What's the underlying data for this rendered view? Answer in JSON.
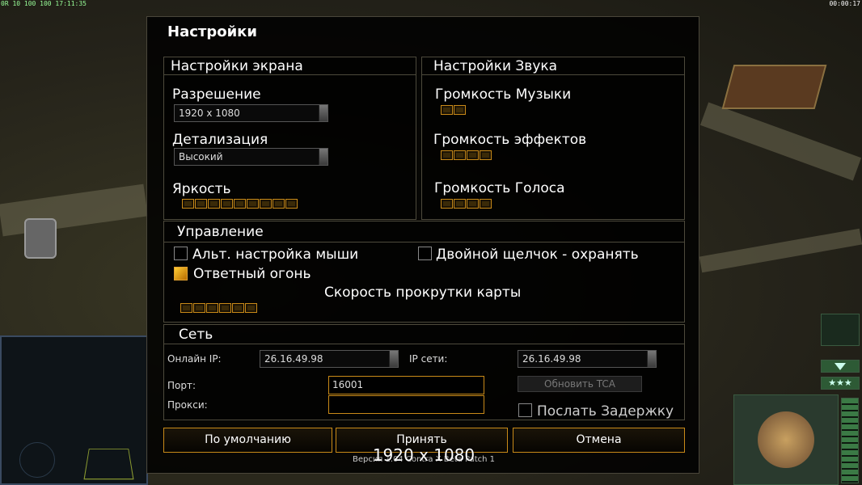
{
  "hud": {
    "top_left": "0R 10 100 100 17:11:35",
    "top_right": "00:00:17"
  },
  "dialog": {
    "title": "Настройки",
    "screen": {
      "header": "Настройки экрана",
      "resolution_label": "Разрешение",
      "resolution_value": "1920 x 1080",
      "detail_label": "Детализация",
      "detail_value": "Высокий",
      "brightness_label": "Яркость",
      "brightness_level": 9
    },
    "sound": {
      "header": "Настройки Звука",
      "music_label": "Громкость Музыки",
      "music_level": 2,
      "effects_label": "Громкость эффектов",
      "effects_level": 4,
      "voice_label": "Громкость Голоса",
      "voice_level": 4
    },
    "controls": {
      "header": "Управление",
      "alt_mouse_label": "Альт. настройка мыши",
      "alt_mouse_checked": false,
      "double_click_label": "Двойной щелчок - охранять",
      "double_click_checked": false,
      "return_fire_label": "Ответный огонь",
      "return_fire_checked": true,
      "scroll_label": "Скорость прокрутки карты",
      "scroll_level": 6
    },
    "network": {
      "header": "Сеть",
      "online_ip_label": "Онлайн IP:",
      "online_ip_value": "26.16.49.98",
      "lan_ip_label": "IP сети:",
      "lan_ip_value": "26.16.49.98",
      "port_label": "Порт:",
      "port_value": "16001",
      "proxy_label": "Прокси:",
      "proxy_value": "",
      "update_tca_label": "Обновить TCA",
      "send_delay_label": "Послать Задержку",
      "send_delay_checked": false
    },
    "buttons": {
      "default": "По умолчанию",
      "accept": "Принять",
      "cancel": "Отмена"
    },
    "version_text": "Версия 1.04 Contra X Beta Patch 1",
    "resolution_overlay": "1920 x 1080"
  },
  "colors": {
    "accent": "#c98a18",
    "panel_border": "#4d4a3c"
  }
}
